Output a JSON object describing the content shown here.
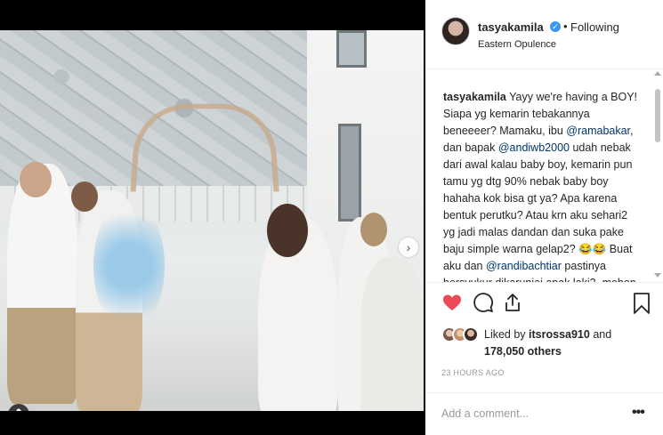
{
  "post": {
    "author": {
      "username": "tasyakamila",
      "verified_glyph": "✓",
      "separator": "•",
      "follow_status": "Following",
      "location": "Eastern Opulence"
    },
    "caption": {
      "username": "tasyakamila",
      "segments": [
        {
          "type": "text",
          "value": " Yayy we're having a BOY! Siapa yg kemarin tebakannya beneeeer? Mamaku, ibu "
        },
        {
          "type": "mention",
          "value": "@ramabakar"
        },
        {
          "type": "text",
          "value": ", dan bapak "
        },
        {
          "type": "mention",
          "value": "@andiwb2000"
        },
        {
          "type": "text",
          "value": " udah nebak dari awal kalau baby boy, kemarin pun tamu yg dtg 90% nebak baby boy hahaha kok bisa gt ya? Apa karena bentuk perutku? Atau krn aku sehari2 yg jadi malas dandan dan suka pake baju simple warna gelap2? 😂😂 Buat aku dan "
        },
        {
          "type": "mention",
          "value": "@randibachtiar"
        },
        {
          "type": "text",
          "value": " pastinya bersyukur dikaruniai anak laki2, mohon"
        }
      ]
    },
    "likes": {
      "prefix": "Liked by ",
      "first_liker": "itsrossa910",
      "middle": " and ",
      "others_count": "178,050 others"
    },
    "timestamp": "23 HOURS AGO",
    "comment": {
      "placeholder": "Add a comment..."
    },
    "more_glyph": "•••"
  },
  "media": {
    "next_glyph": "›",
    "dots_count": 7,
    "active_dot": 0,
    "tag_glyph": "👤"
  },
  "icons": {
    "like": "heart-icon",
    "comment": "comment-icon",
    "share": "share-icon",
    "save": "bookmark-icon",
    "verified": "verified-badge-icon",
    "like_color": "#ed4956",
    "mention_color": "#003569",
    "verified_color": "#3897f0"
  }
}
